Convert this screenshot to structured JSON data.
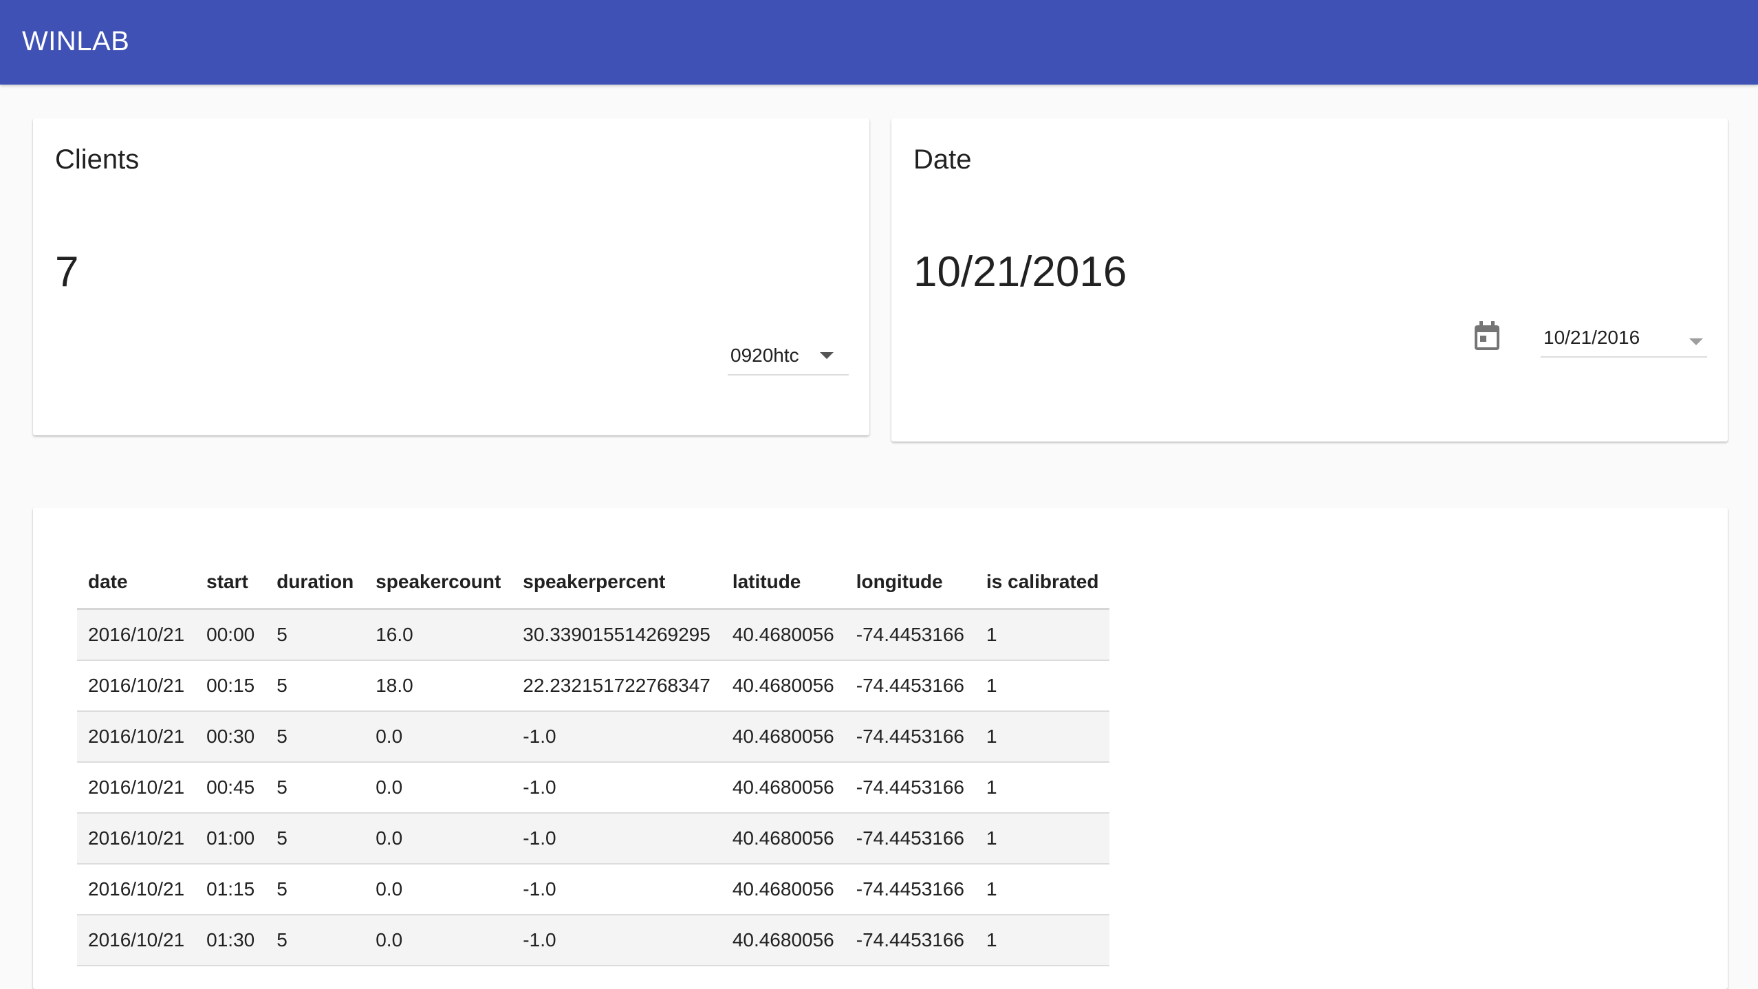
{
  "app": {
    "title": "WINLAB",
    "colors": {
      "appbar": "#3f51b5",
      "background": "#fafafa",
      "card": "#ffffff"
    }
  },
  "clients": {
    "title": "Clients",
    "count": "7",
    "selected_client": "0920htc",
    "dropdown_icon": "arrow-drop-down-icon"
  },
  "date_card": {
    "title": "Date",
    "value": "10/21/2016",
    "picker_value": "10/21/2016",
    "calendar_icon": "calendar-icon",
    "dropdown_icon": "arrow-drop-down-icon"
  },
  "table": {
    "columns": [
      "date",
      "start",
      "duration",
      "speakercount",
      "speakerpercent",
      "latitude",
      "longitude",
      "is calibrated"
    ],
    "rows": [
      [
        "2016/10/21",
        "00:00",
        "5",
        "16.0",
        "30.339015514269295",
        "40.4680056",
        "-74.4453166",
        "1"
      ],
      [
        "2016/10/21",
        "00:15",
        "5",
        "18.0",
        "22.232151722768347",
        "40.4680056",
        "-74.4453166",
        "1"
      ],
      [
        "2016/10/21",
        "00:30",
        "5",
        "0.0",
        "-1.0",
        "40.4680056",
        "-74.4453166",
        "1"
      ],
      [
        "2016/10/21",
        "00:45",
        "5",
        "0.0",
        "-1.0",
        "40.4680056",
        "-74.4453166",
        "1"
      ],
      [
        "2016/10/21",
        "01:00",
        "5",
        "0.0",
        "-1.0",
        "40.4680056",
        "-74.4453166",
        "1"
      ],
      [
        "2016/10/21",
        "01:15",
        "5",
        "0.0",
        "-1.0",
        "40.4680056",
        "-74.4453166",
        "1"
      ],
      [
        "2016/10/21",
        "01:30",
        "5",
        "0.0",
        "-1.0",
        "40.4680056",
        "-74.4453166",
        "1"
      ]
    ]
  }
}
